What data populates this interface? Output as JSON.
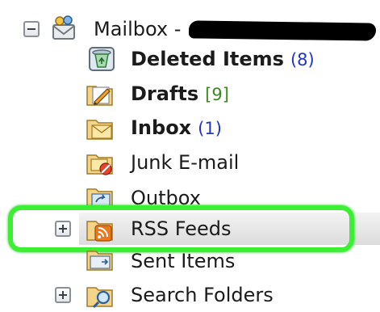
{
  "root": {
    "label": "Mailbox -"
  },
  "folders": [
    {
      "label": "Deleted Items",
      "count": "(8)",
      "bold": true,
      "count_color": "#1f35c9",
      "icon": "deleted-items-icon"
    },
    {
      "label": "Drafts",
      "count": "[9]",
      "bold": true,
      "count_color": "#3a8a1c",
      "icon": "drafts-icon"
    },
    {
      "label": "Inbox",
      "count": "(1)",
      "bold": true,
      "count_color": "#1f35c9",
      "icon": "inbox-icon"
    },
    {
      "label": "Junk E-mail",
      "icon": "junk-email-icon"
    },
    {
      "label": "Outbox",
      "icon": "outbox-icon"
    },
    {
      "label": "RSS Feeds",
      "icon": "rss-feeds-icon",
      "expandable": true,
      "highlighted": true
    },
    {
      "label": "Sent Items",
      "icon": "sent-items-icon"
    },
    {
      "label": "Search Folders",
      "icon": "search-folders-icon",
      "expandable": true
    }
  ],
  "colors": {
    "highlight": "#3bf033",
    "count_blue": "#1f35c9",
    "count_green": "#3a8a1c"
  }
}
